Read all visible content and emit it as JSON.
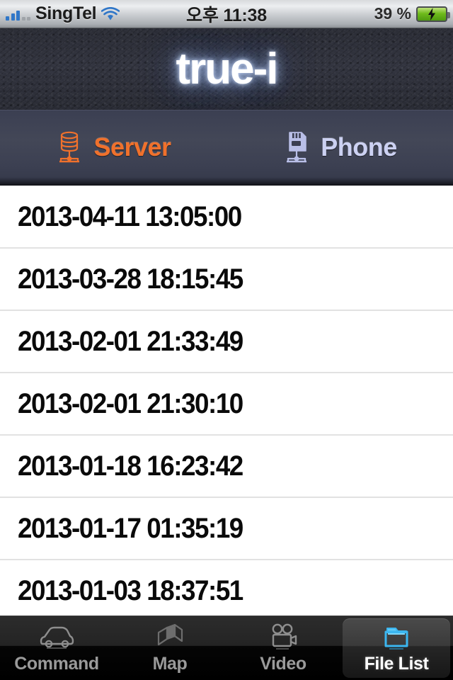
{
  "status_bar": {
    "carrier": "SingTel",
    "wifi_icon": "wifi-icon",
    "signal_icon": "signal-bars-icon",
    "time": "오후 11:38",
    "battery_percent": "39 %",
    "battery_icon": "battery-charging-icon"
  },
  "header": {
    "logo_text": "true-i"
  },
  "source_bar": {
    "segments": [
      {
        "label": "Server",
        "icon": "database-server-icon",
        "color": "#f0712c",
        "selected": true
      },
      {
        "label": "Phone",
        "icon": "sd-card-icon",
        "color": "#ccd1f2",
        "selected": false
      }
    ]
  },
  "file_list": {
    "rows": [
      {
        "timestamp": "2013-04-11 13:05:00"
      },
      {
        "timestamp": "2013-03-28 18:15:45"
      },
      {
        "timestamp": "2013-02-01 21:33:49"
      },
      {
        "timestamp": "2013-02-01 21:30:10"
      },
      {
        "timestamp": "2013-01-18 16:23:42"
      },
      {
        "timestamp": "2013-01-17 01:35:19"
      },
      {
        "timestamp": "2013-01-03 18:37:51"
      }
    ]
  },
  "tab_bar": {
    "tabs": [
      {
        "label": "Command",
        "icon": "car-icon",
        "active": false
      },
      {
        "label": "Map",
        "icon": "map-icon",
        "active": false
      },
      {
        "label": "Video",
        "icon": "video-camera-icon",
        "active": false
      },
      {
        "label": "File List",
        "icon": "folder-icon",
        "active": true
      }
    ],
    "active_icon_color": "#3bb6f0"
  }
}
